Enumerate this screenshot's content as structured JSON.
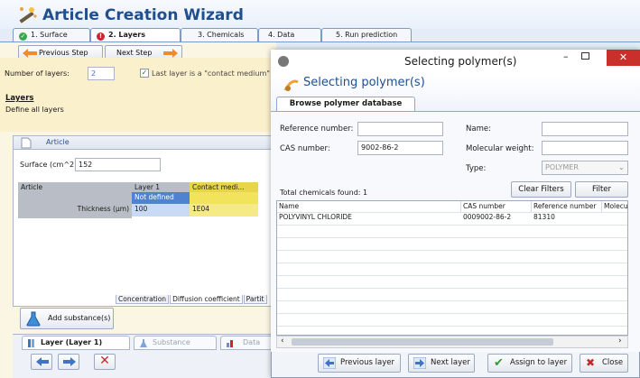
{
  "app": {
    "title": "Article Creation Wizard"
  },
  "tabs": [
    {
      "label": "1. Surface",
      "status": "ok"
    },
    {
      "label": "2. Layers",
      "status": "error"
    },
    {
      "label": "3. Chemicals"
    },
    {
      "label": "4. Data"
    },
    {
      "label": "5. Run prediction"
    }
  ],
  "nav": {
    "previous": "Previous Step",
    "next": "Next Step"
  },
  "layers": {
    "count_label": "Number of layers:",
    "count_value": "2",
    "contact_checkbox": "Last layer is a \"contact medium\" la",
    "heading": "Layers",
    "hint": "Define all layers"
  },
  "article": {
    "tab": "Article",
    "surface_label": "Surface (cm^2)",
    "surface_value": "152",
    "grid": {
      "row_label": "Article",
      "col1": "Layer 1",
      "col2": "Contact medi...",
      "not_defined": "Not defined",
      "thickness_label": "Thickness (µm)",
      "thickness1": "100",
      "thickness2": "1E04"
    },
    "subtabs": [
      "Concentration",
      "Diffusion coefficient",
      "Partit"
    ],
    "add_substance": "Add substance(s)"
  },
  "bottom_tabs": [
    "Layer (Layer 1)",
    "Substance",
    "Data"
  ],
  "dialog": {
    "window_title": "Selecting polymer(s)",
    "header": "Selecting polymer(s)",
    "tab": "Browse polymer database",
    "ref_label": "Reference number:",
    "ref_value": "",
    "cas_label": "CAS number:",
    "cas_value": "9002-86-2",
    "name_label": "Name:",
    "name_value": "",
    "mw_label": "Molecular weight:",
    "mw_value": "",
    "type_label": "Type:",
    "type_value": "POLYMER",
    "total_label": "Total chemicals found:",
    "total_value": "1",
    "clear_filters": "Clear Filters",
    "filter": "Filter",
    "columns": [
      "Name",
      "CAS number",
      "Reference number",
      "Molecu"
    ],
    "rows": [
      [
        "POLYVINYL CHLORIDE",
        "0009002-86-2",
        "81310",
        ""
      ]
    ],
    "buttons": {
      "previous_layer": "Previous layer",
      "next_layer": "Next layer",
      "assign": "Assign to layer",
      "close": "Close"
    }
  },
  "colors": {
    "title": "#1f4f8f",
    "accent_blue": "#3e74c6",
    "close_red": "#c9302c",
    "grid_grey": "#b9bec6",
    "grid_blue": "#4f83d1",
    "grid_yellow": "#f2e35c"
  }
}
